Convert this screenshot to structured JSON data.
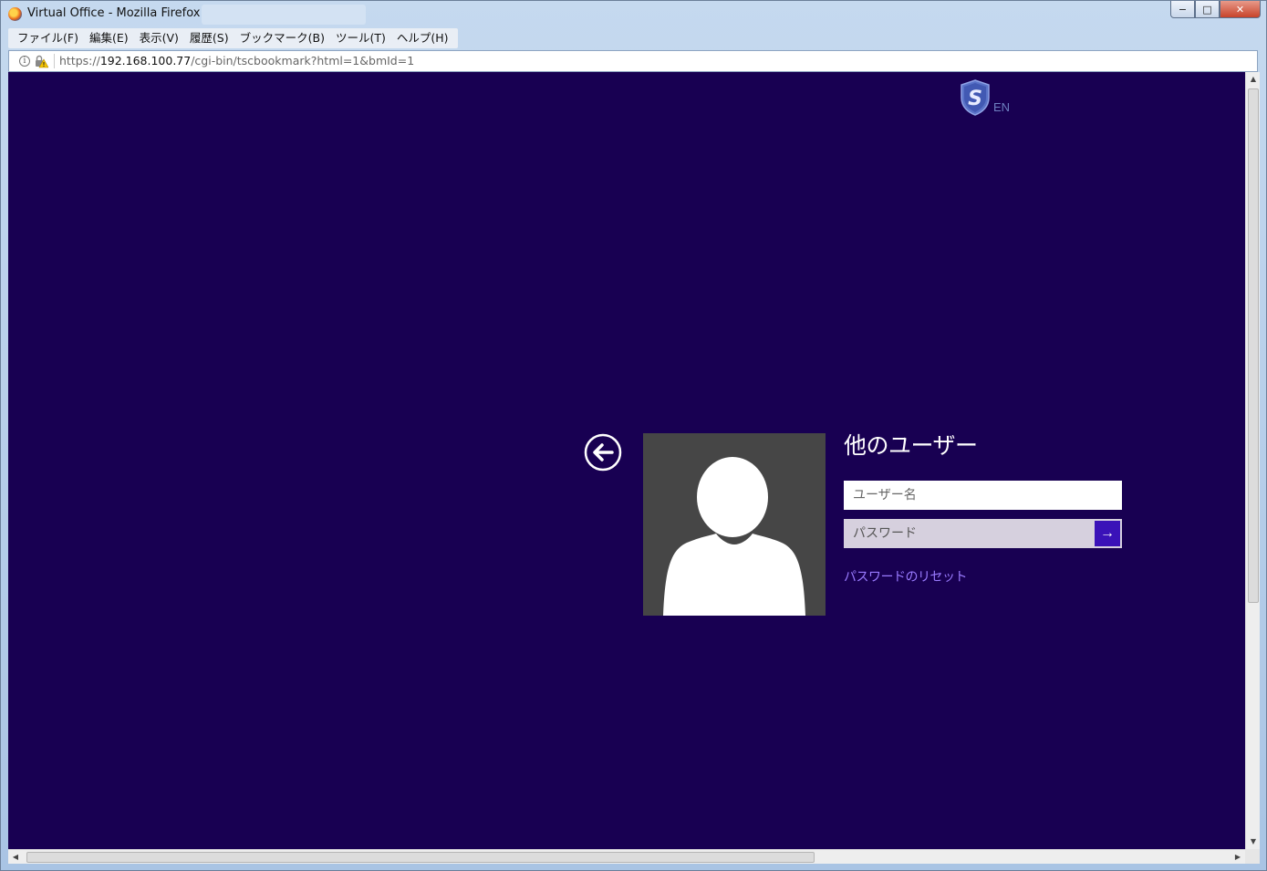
{
  "window": {
    "title": "Virtual Office - Mozilla Firefox",
    "controls": {
      "minimize": "−",
      "maximize": "□",
      "close": "✕"
    }
  },
  "menubar": {
    "items": [
      {
        "label": "ファイル(F)"
      },
      {
        "label": "編集(E)"
      },
      {
        "label": "表示(V)"
      },
      {
        "label": "履歴(S)"
      },
      {
        "label": "ブックマーク(B)"
      },
      {
        "label": "ツール(T)"
      },
      {
        "label": "ヘルプ(H)"
      }
    ]
  },
  "urlbar": {
    "scheme": "https://",
    "host": "192.168.100.77",
    "path": "/cgi-bin/tscbookmark?html=1&bmId=1"
  },
  "page": {
    "background": "#180052",
    "language_link": "EN",
    "login": {
      "title": "他のユーザー",
      "username_placeholder": "ユーザー名",
      "password_placeholder": "パスワード",
      "submit_icon": "→",
      "reset_link": "パスワードのリセット"
    },
    "colors": {
      "accent": "#3a12b8",
      "link": "#9a7bff",
      "avatar_bg": "#464646"
    }
  },
  "scrollbars": {
    "up": "▲",
    "down": "▼",
    "left": "◀",
    "right": "▶"
  }
}
